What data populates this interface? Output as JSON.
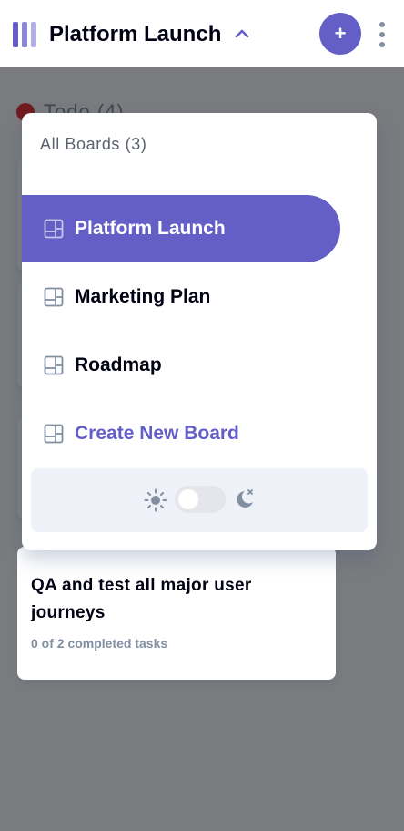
{
  "header": {
    "board_name": "Platform Launch",
    "add_task_label": "+",
    "logo_icon": "kanban-logo-icon",
    "chevron_icon": "chevron-up-icon",
    "menu_icon": "vertical-ellipsis-icon"
  },
  "column": {
    "title": "Todo (4)",
    "dot_color": "#e0393e"
  },
  "cards": [
    {
      "title": "QA and test all major user journeys",
      "subtitle": "0 of 2 completed tasks"
    }
  ],
  "board_menu": {
    "heading": "All Boards (3)",
    "boards": [
      {
        "label": "Platform Launch",
        "active": true
      },
      {
        "label": "Marketing Plan",
        "active": false
      },
      {
        "label": "Roadmap",
        "active": false
      }
    ],
    "create_label": "Create New Board",
    "board_icon": "board-icon"
  },
  "theme": {
    "light_icon": "sun-icon",
    "dark_icon": "moon-icon",
    "dark_mode": false
  },
  "colors": {
    "accent": "#635fc7",
    "text_dark": "#000112",
    "text_muted": "#828fa3",
    "background": "#f4f7fd"
  }
}
